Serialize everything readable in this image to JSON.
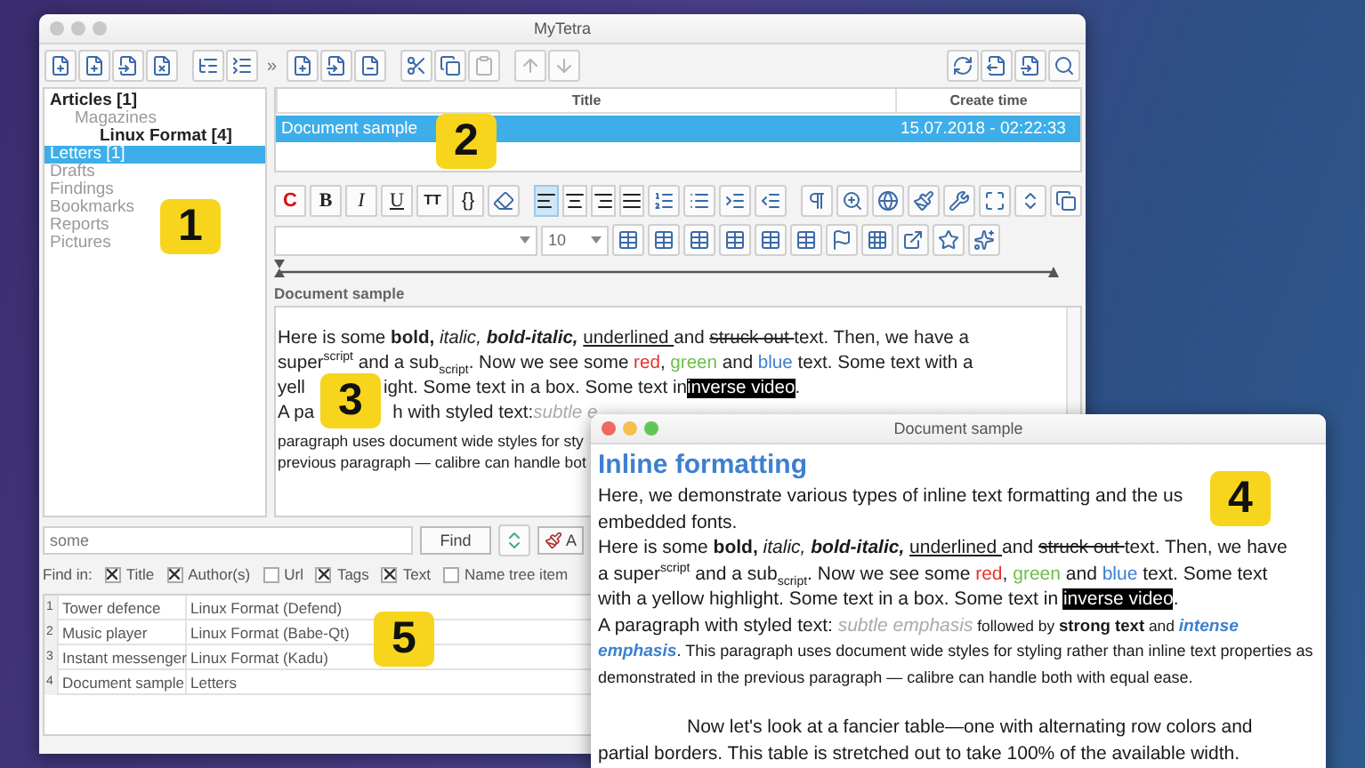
{
  "main_window": {
    "title": "MyTetra",
    "toolbar_overflow": "»"
  },
  "tree": [
    {
      "label": "Articles [1]",
      "bold": true,
      "selected": false,
      "children": [
        {
          "label": "Magazines",
          "bold": false,
          "selected": false,
          "children": [
            {
              "label": "Linux Format [4]",
              "bold": true,
              "selected": false
            }
          ]
        }
      ]
    },
    {
      "label": "Letters [1]",
      "bold": false,
      "selected": true
    },
    {
      "label": "Drafts",
      "bold": false,
      "selected": false
    },
    {
      "label": "Findings",
      "bold": false,
      "selected": false
    },
    {
      "label": "Bookmarks",
      "bold": false,
      "selected": false
    },
    {
      "label": "Reports",
      "bold": false,
      "selected": false
    },
    {
      "label": "Pictures",
      "bold": false,
      "selected": false
    }
  ],
  "records": {
    "columns": [
      "Title",
      "Create time"
    ],
    "rows": [
      {
        "title": "Document sample",
        "created": "15.07.2018 - 02:22:33",
        "selected": true
      }
    ]
  },
  "format_buttons": [
    {
      "label": "C",
      "kind": "color"
    },
    {
      "label": "B",
      "kind": "bold"
    },
    {
      "label": "I",
      "kind": "italic"
    },
    {
      "label": "U",
      "kind": "underline"
    },
    {
      "label": "TT",
      "kind": "mono"
    },
    {
      "label": "{}",
      "kind": "code"
    }
  ],
  "alignment": [
    {
      "selected": true
    },
    {
      "selected": false
    },
    {
      "selected": false
    },
    {
      "selected": false
    }
  ],
  "font_size": "10",
  "editor": {
    "label": "Document sample",
    "lines": [
      [
        {
          "text": "Here is some ",
          "kind": "plain"
        },
        {
          "text": "bold, ",
          "kind": "bold"
        },
        {
          "text": "italic, ",
          "kind": "italic"
        },
        {
          "text": "bold-italic, ",
          "kind": "bolditalic"
        },
        {
          "text": "underlined ",
          "kind": "underline"
        },
        {
          "text": "and ",
          "kind": "plain"
        },
        {
          "text": "struck out ",
          "kind": "strike"
        },
        {
          "text": "text. Then, we have a",
          "kind": "plain"
        }
      ],
      [
        {
          "text": "super",
          "kind": "plain"
        },
        {
          "text": "script",
          "kind": "sup"
        },
        {
          "text": " and a sub",
          "kind": "plain"
        },
        {
          "text": "script",
          "kind": "sub"
        },
        {
          "text": ". Now we see some ",
          "kind": "plain"
        },
        {
          "text": "red",
          "kind": "red"
        },
        {
          "text": ", ",
          "kind": "plain"
        },
        {
          "text": "green",
          "kind": "green"
        },
        {
          "text": " and ",
          "kind": "plain"
        },
        {
          "text": "blue",
          "kind": "blue"
        },
        {
          "text": " text. Some text with a",
          "kind": "plain"
        }
      ],
      [
        {
          "text": "yell",
          "kind": "plain"
        },
        {
          "text": "ight. Some text in a box. Some text in ",
          "kind": "plain",
          "gap_before": true
        },
        {
          "text": "inverse video",
          "kind": "inverse"
        },
        {
          "text": ".",
          "kind": "plain"
        }
      ],
      [
        {
          "text": "A pa",
          "kind": "plain"
        },
        {
          "text": "h with styled text: ",
          "kind": "plain",
          "gap_before": true
        },
        {
          "text": "subtle e",
          "kind": "subtle"
        }
      ],
      [
        {
          "text": "paragraph uses document wide styles for sty",
          "kind": "small"
        }
      ],
      [
        {
          "text": "previous paragraph — calibre can handle bot",
          "kind": "small"
        }
      ]
    ]
  },
  "search": {
    "value": "some",
    "find_button": "Find",
    "next_button": "A",
    "find_in_label": "Find in:",
    "options": [
      {
        "label": "Title",
        "checked": true
      },
      {
        "label": "Author(s)",
        "checked": true
      },
      {
        "label": "Url",
        "checked": false
      },
      {
        "label": "Tags",
        "checked": true
      },
      {
        "label": "Text",
        "checked": true
      },
      {
        "label": "Name tree item",
        "checked": false
      }
    ]
  },
  "results": [
    {
      "number": "1",
      "title": "Tower defence",
      "path": "Linux Format (Defend)"
    },
    {
      "number": "2",
      "title": "Music player",
      "path": "Linux Format (Babe-Qt)"
    },
    {
      "number": "3",
      "title": "Instant messenger",
      "path": "Linux Format (Kadu)"
    },
    {
      "number": "4",
      "title": "Document sample",
      "path": "Letters"
    }
  ],
  "preview_window": {
    "title": "Document sample",
    "heading": "Inline formatting",
    "lines": [
      {
        "indent": false,
        "segments": [
          {
            "text": "Here, we demonstrate various types of inline text formatting and the us",
            "kind": "plain"
          }
        ]
      },
      {
        "indent": false,
        "segments": [
          {
            "text": "embedded fonts.",
            "kind": "plain"
          }
        ]
      },
      {
        "indent": false,
        "segments": [
          {
            "text": "Here is some ",
            "kind": "plain"
          },
          {
            "text": "bold, ",
            "kind": "bold"
          },
          {
            "text": "italic, ",
            "kind": "italic"
          },
          {
            "text": "bold-italic, ",
            "kind": "bolditalic"
          },
          {
            "text": "underlined ",
            "kind": "underline"
          },
          {
            "text": "and ",
            "kind": "plain"
          },
          {
            "text": "struck out ",
            "kind": "strike"
          },
          {
            "text": "text. Then, we have",
            "kind": "plain"
          }
        ]
      },
      {
        "indent": false,
        "segments": [
          {
            "text": "a super",
            "kind": "plain"
          },
          {
            "text": "script",
            "kind": "sup"
          },
          {
            "text": " and a sub",
            "kind": "plain"
          },
          {
            "text": "script",
            "kind": "sub"
          },
          {
            "text": ". Now we see some ",
            "kind": "plain"
          },
          {
            "text": "red",
            "kind": "red"
          },
          {
            "text": ", ",
            "kind": "plain"
          },
          {
            "text": "green",
            "kind": "green"
          },
          {
            "text": " and ",
            "kind": "plain"
          },
          {
            "text": "blue",
            "kind": "blue"
          },
          {
            "text": " text. Some text",
            "kind": "plain"
          }
        ]
      },
      {
        "indent": false,
        "segments": [
          {
            "text": "with a yellow highlight. Some text in a box. Some text in ",
            "kind": "plain"
          },
          {
            "text": "inverse video",
            "kind": "inverse"
          },
          {
            "text": ".",
            "kind": "plain"
          }
        ]
      },
      {
        "indent": false,
        "segments": [
          {
            "text": "A paragraph with styled text: ",
            "kind": "plain"
          },
          {
            "text": "subtle emphasis",
            "kind": "subtle"
          },
          {
            "text": " followed by ",
            "kind": "small"
          },
          {
            "text": "strong text",
            "kind": "strong"
          },
          {
            "text": " and ",
            "kind": "small"
          },
          {
            "text": "intense",
            "kind": "intense"
          }
        ]
      },
      {
        "indent": false,
        "segments": [
          {
            "text": "emphasis",
            "kind": "intense"
          },
          {
            "text": ". This paragraph uses document wide styles for styling rather than inline text properties as",
            "kind": "tiny"
          }
        ]
      },
      {
        "indent": false,
        "segments": [
          {
            "text": "demonstrated in the previous paragraph — calibre can handle both with equal ease.",
            "kind": "tiny"
          }
        ]
      },
      {
        "indent": true,
        "segments": [
          {
            "text": "Now let's look at a fancier table—one with alternating row colors and",
            "kind": "plain"
          }
        ]
      },
      {
        "indent": false,
        "segments": [
          {
            "text": "partial borders. This table is stretched out to take 100% of the available width.",
            "kind": "plain"
          }
        ]
      }
    ]
  },
  "callouts": [
    {
      "label": "1"
    },
    {
      "label": "2"
    },
    {
      "label": "3"
    },
    {
      "label": "4"
    },
    {
      "label": "5"
    }
  ]
}
